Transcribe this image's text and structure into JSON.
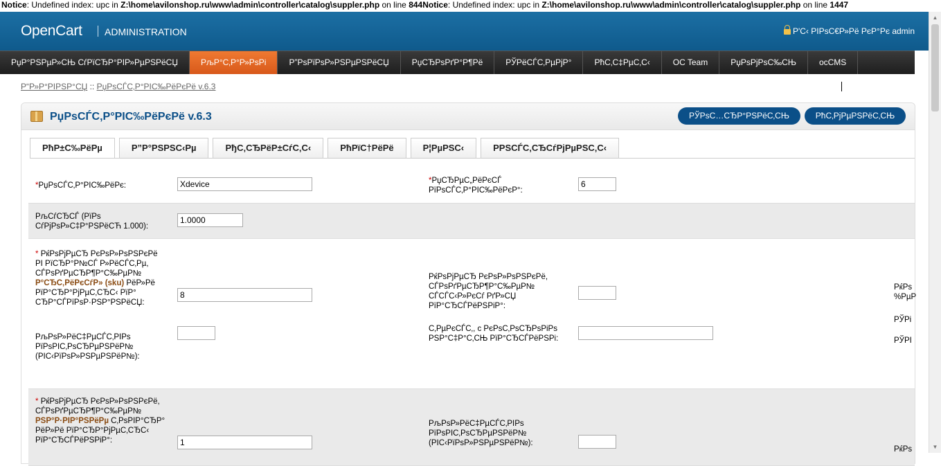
{
  "notice": {
    "part1_label": "Notice",
    "part1_text": ": Undefined index: upc in ",
    "part1_path": "Z:\\home\\avilonshop.ru\\www\\admin\\controller\\catalog\\suppler.php",
    "part1_online": " on line ",
    "part1_line": "844",
    "part2_label": "Notice",
    "part2_text": ": Undefined index: upc in ",
    "part2_path": "Z:\\home\\avilonshop.ru\\www\\admin\\controller\\catalog\\suppler.php",
    "part2_online": " on line ",
    "part2_line": "1447"
  },
  "header": {
    "logo": "OpenCart",
    "admin": "ADMINISTRATION",
    "logged_in": "Р'С‹ РІРѕС€Р»Рё РєР°Рє admin"
  },
  "menu": [
    "РџР°РЅРµР»СЊ СѓРїСЂР°РІР»РµРЅРёСЏ",
    "РљР°С‚Р°Р»РѕРі",
    "Р”РѕРїРѕР»РЅРµРЅРёСЏ",
    "РџСЂРѕРґР°Р¶Рё",
    "РЎРёСЃС‚РµРјР°",
    "РћС‚С‡РµС‚С‹",
    "OC Team",
    "РџРѕРјРѕС‰СЊ",
    "ocCMS"
  ],
  "breadcrumb": {
    "home": "Р“Р»Р°РІРЅР°СЏ",
    "sep": " :: ",
    "current": "РџРѕСЃС‚Р°РІС‰РёРєРё v.6.3"
  },
  "box": {
    "title": "РџРѕСЃС‚Р°РІС‰РёРєРё v.6.3",
    "save": "РЎРѕС…СЂР°РЅРёС‚СЊ",
    "cancel": "РћС‚РјРµРЅРёС‚СЊ"
  },
  "tabs": [
    "РћР±С‰РёРµ",
    "Р”Р°РЅРЅС‹Рµ",
    "РђС‚СЂРёР±СѓС‚С‹",
    "РћРїС†РёРё",
    "Р¦РµРЅС‹",
    "РРЅСЃС‚СЂСѓРјРµРЅС‚С‹"
  ],
  "form": {
    "supplier_label_req": "*",
    "supplier_label": "РџРѕСЃС‚Р°РІС‰РёРє:",
    "supplier_value": "Xdevice",
    "prefix_label_req": "*",
    "prefix_label": "РџСЂРµС„РёРєСЃ РїРѕСЃС‚Р°РІС‰РёРєР°:",
    "prefix_value": "6",
    "rate_label": "РљСѓСЂСЃ (РїРѕ СѓРјРѕР»С‡Р°РЅРёСЋ 1.000):",
    "rate_value": "1.0000",
    "sku_req": "*",
    "sku_label_a": "РќРѕРјРµСЂ РєРѕР»РѕРЅРєРё РІ РїСЂР°Р№СЃ Р»РёСЃС‚Рµ, СЃРѕРґРµСЂР¶Р°С‰РµР№ ",
    "sku_label_hl": "Р°СЂС‚РёРєСѓР» (sku)",
    "sku_label_b": " РёР»Рё РїР°СЂР°РјРµС‚СЂС‹ РїР° СЂР°СЃРїРѕР·РЅР°РЅРёСЏ:",
    "sku_value": "8",
    "count_label": "РљРѕР»РёС‡РµСЃС‚РІРѕ РїРѕРІС‚РѕСЂРµРЅРёР№ (РІС‹РїРѕР»РЅРµРЅРёР№):",
    "count_value": "",
    "url_col_label": "РќРѕРјРµСЂ РєРѕР»РѕРЅРєРё, СЃРѕРґРµСЂР¶Р°С‰РµР№ СЃСЃС‹Р»РєСѓ РґР»СЏ РїР°СЂСЃРёРЅРіР°:",
    "url_col_value": "",
    "text_label": "С‚РµРєСЃС‚, с РєРѕС‚РѕСЂРѕРіРѕ РЅР°С‡Р°С‚СЊ РїР°СЂСЃРёРЅРі:",
    "text_value": "",
    "name_req": "*",
    "name_label_a": "РќРѕРјРµСЂ РєРѕР»РѕРЅРєРё, СЃРѕРґРµСЂР¶Р°С‰РµР№ ",
    "name_label_hl": "РЅР°Р·РІР°РЅРёРµ",
    "name_label_b": " С‚РѕРІР°СЂР° РёР»Рё РїР°СЂР°РјРµС‚СЂС‹ РїР°СЂСЃРёРЅРіР°:",
    "name_value": "1",
    "count2_label": "РљРѕР»РёС‡РµСЃС‚РІРѕ РїРѕРІС‚РѕСЂРµРЅРёР№ (РІС‹РїРѕР»РЅРµРЅРёР№):",
    "count2_value": "",
    "clip_r1": "РќРѕ",
    "clip_r2": "%РµР",
    "clip_r3": "РЎРі",
    "clip_r4": "РЎРІ",
    "clip_r5": "РќРѕ"
  }
}
